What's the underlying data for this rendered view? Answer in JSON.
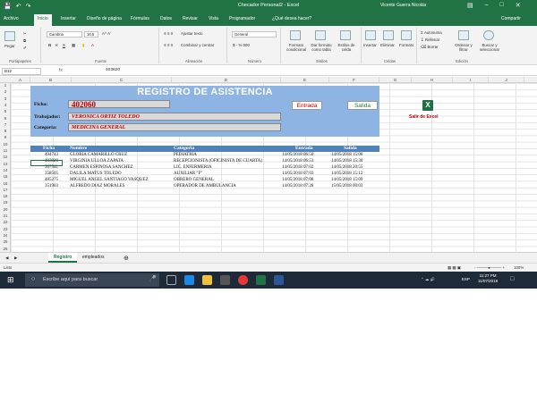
{
  "window": {
    "title": "Checador Personal2 - Excel",
    "user": "Vicente Guerra Nicolás"
  },
  "menu": [
    "Archivo",
    "Inicio",
    "Insertar",
    "Diseño de página",
    "Fórmulas",
    "Datos",
    "Revisar",
    "Vista",
    "Programador",
    "¿Qué desea hacer?"
  ],
  "share": "Compartir",
  "ribbon": {
    "paste": "Pegar",
    "font_name": "Cambria",
    "font_size": "10,5",
    "wrap": "Ajustar texto",
    "merge": "Combinar y centrar",
    "number_format": "General",
    "cond_format": "Formato condicional",
    "table_format": "Dar formato como tabla",
    "cell_styles": "Estilos de celda",
    "insert": "Insertar",
    "delete": "Eliminar",
    "format": "Formato",
    "autosum": "Autosuma",
    "fill": "Rellenar",
    "clear": "Borrar",
    "sort": "Ordenar y filtrar",
    "find": "Buscar y seleccionar",
    "groups": [
      "Portapapeles",
      "Fuente",
      "Alineación",
      "Número",
      "Estilos",
      "Celdas",
      "Edición"
    ]
  },
  "formula_bar": {
    "cell": "B12",
    "fx": "fx",
    "value": "403820"
  },
  "columns": [
    "A",
    "B",
    "C",
    "D",
    "E",
    "F",
    "G",
    "H",
    "I",
    "J"
  ],
  "rows": [
    "1",
    "2",
    "3",
    "4",
    "5",
    "6",
    "7",
    "8",
    "9",
    "10",
    "11",
    "12",
    "13",
    "14",
    "15",
    "16",
    "17",
    "18",
    "19",
    "20",
    "21",
    "22",
    "23",
    "24",
    "25",
    "26"
  ],
  "form": {
    "title": "REGISTRO DE ASISTENCIA",
    "ficha_label": "Ficha:",
    "ficha_value": "402060",
    "trabajador_label": "Trabajador:",
    "trabajador_value": "VERONICA ORTIZ TOLEDO",
    "categoria_label": "Categoria:",
    "categoria_value": "MEDICINA GENERAL",
    "entrada_btn": "Entrada",
    "salida_btn": "Salida"
  },
  "table": {
    "headers": [
      "Ficha",
      "Nombre",
      "Categoria",
      "Entrada",
      "Salida"
    ],
    "rows": [
      [
        "494743",
        "GLORIA CAMARILLO CRUZ",
        "PEDIATRIA",
        "14/05/2018 06:50",
        "14/05/2018 15:00"
      ],
      [
        "403820",
        "VIRGINIA ULLOA ZAPATA",
        "RECEPCIONISTA (OFICINISTA DE CUARTA)",
        "14/05/2018 06:53",
        "14/05/2018 15:30"
      ],
      [
        "507541",
        "CARMEN ESPINOSA SANCHEZ",
        "LIC. ENFERMERIA",
        "14/05/2018 07:02",
        "14/05/2018 20:55"
      ],
      [
        "358505",
        "DALILA MATUS TOLEDO",
        "AUXILIAR \"F\"",
        "14/05/2018 07:03",
        "14/05/2018 15:12"
      ],
      [
        "485275",
        "MIGUEL ANGEL SANTIAGO VASQUEZ",
        "OBRERO GENERAL",
        "14/05/2018 07:08",
        "14/05/2018 15:09"
      ],
      [
        "351903",
        "ALFREDO DIAZ MORALES",
        "OPERADOR DE AMBULANCIA",
        "14/05/2018 07:28",
        "15/05/2018 00:03"
      ]
    ]
  },
  "exit_button": "Salir de Excel",
  "sheets": [
    "Registro",
    "empleados"
  ],
  "status": {
    "ready": "Listo",
    "zoom": "100%"
  },
  "taskbar": {
    "search_placeholder": "Escribe aquí para buscar",
    "lang": "ESP",
    "time": "11:27 PM",
    "date": "11/07/2018"
  }
}
